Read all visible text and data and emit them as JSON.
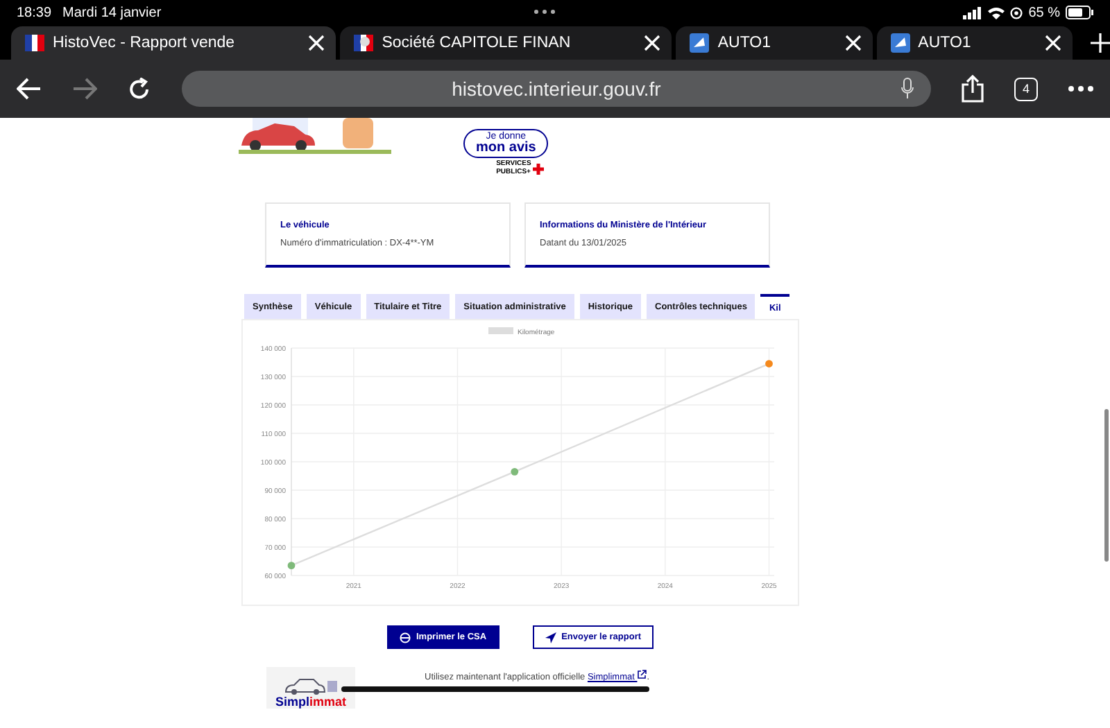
{
  "status_bar": {
    "time": "18:39",
    "date": "Mardi 14 janvier",
    "battery": "65 %"
  },
  "browser_tabs": [
    {
      "title": "HistoVec - Rapport vende",
      "kind": "flag",
      "selected": true
    },
    {
      "title": "Société CAPITOLE FINAN",
      "kind": "marianne",
      "selected": false
    },
    {
      "title": "AUTO1",
      "kind": "auto",
      "selected": false
    },
    {
      "title": "AUTO1",
      "kind": "auto",
      "selected": false
    }
  ],
  "address_bar": {
    "url": "histovec.interieur.gouv.fr",
    "tab_count": "4"
  },
  "feedback_badge": {
    "line1": "Je donne",
    "line2": "mon avis",
    "caption1": "SERVICES",
    "caption2": "PUBLICS+"
  },
  "info_cards": [
    {
      "title": "Le véhicule",
      "text": "Numéro d'immatriculation : DX-4**-YM"
    },
    {
      "title": "Informations du Ministère de l'Intérieur",
      "text": "Datant du 13/01/2025"
    }
  ],
  "section_tabs": [
    {
      "label": "Synthèse",
      "selected": false
    },
    {
      "label": "Véhicule",
      "selected": false
    },
    {
      "label": "Titulaire et Titre",
      "selected": false
    },
    {
      "label": "Situation administrative",
      "selected": false
    },
    {
      "label": "Historique",
      "selected": false
    },
    {
      "label": "Contrôles techniques",
      "selected": false
    },
    {
      "label": "Kil",
      "selected": true
    }
  ],
  "chart_data": {
    "type": "line",
    "x": [
      2020.4,
      2022.55,
      2025.0
    ],
    "series": [
      {
        "name": "Kilométrage",
        "color": "#dddddd",
        "marker": true,
        "values": [
          63500,
          96500,
          134500
        ]
      }
    ],
    "grid": true,
    "xlim": [
      2020.4,
      2025.05
    ],
    "ylim": [
      60000,
      140000
    ],
    "xticks": [
      2021,
      2022,
      2023,
      2024,
      2025
    ],
    "yticks": [
      {
        "value": 60000,
        "label": "60 000"
      },
      {
        "value": 70000,
        "label": "70 000"
      },
      {
        "value": 80000,
        "label": "80 000"
      },
      {
        "value": 90000,
        "label": "90 000"
      },
      {
        "value": 100000,
        "label": "100 000"
      },
      {
        "value": 110000,
        "label": "110 000"
      },
      {
        "value": 120000,
        "label": "120 000"
      },
      {
        "value": 130000,
        "label": "130 000"
      },
      {
        "value": 140000,
        "label": "140 000"
      }
    ]
  },
  "actions": [
    {
      "label": "Imprimer le CSA",
      "kind": "primary"
    },
    {
      "label": "Envoyer le rapport",
      "kind": "secondary"
    }
  ],
  "promo": {
    "logo_part1": "Simpl",
    "logo_part2": "immat",
    "text": "Utilisez maintenant l'application officielle",
    "link": "Simplimmat",
    "after": "."
  }
}
